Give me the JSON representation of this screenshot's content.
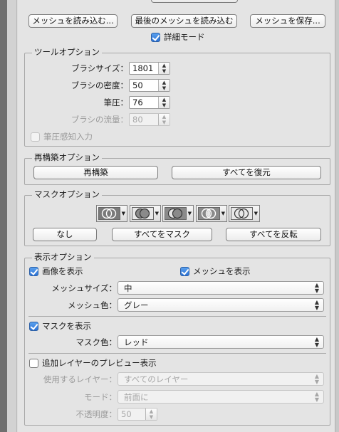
{
  "top_buttons": {
    "load_mesh": "メッシュを読み込む...",
    "load_last_mesh": "最後のメッシュを読み込む",
    "save_mesh": "メッシュを保存..."
  },
  "advanced_mode": {
    "label": "詳細モード",
    "checked": true
  },
  "tool_options": {
    "title": "ツールオプション",
    "brush_size": {
      "label": "ブラシサイズ：",
      "value": "1801"
    },
    "brush_density": {
      "label": "ブラシの密度：",
      "value": "50"
    },
    "brush_pressure": {
      "label": "筆圧：",
      "value": "76"
    },
    "brush_rate": {
      "label": "ブラシの流量：",
      "value": "80"
    },
    "stylus_pressure": {
      "label": "筆圧感知入力",
      "checked": false
    }
  },
  "reconstruct_options": {
    "title": "再構築オプション",
    "reconstruct": "再構築",
    "restore_all": "すべてを復元"
  },
  "mask_options": {
    "title": "マスクオプション",
    "none": "なし",
    "mask_all": "すべてをマスク",
    "invert_all": "すべてを反転"
  },
  "view_options": {
    "title": "表示オプション",
    "show_image": {
      "label": "画像を表示",
      "checked": true
    },
    "show_mesh": {
      "label": "メッシュを表示",
      "checked": true
    },
    "mesh_size": {
      "label": "メッシュサイズ：",
      "value": "中"
    },
    "mesh_color": {
      "label": "メッシュ色：",
      "value": "グレー"
    },
    "show_mask": {
      "label": "マスクを表示",
      "checked": true
    },
    "mask_color": {
      "label": "マスク色：",
      "value": "レッド"
    },
    "show_backdrop": {
      "label": "追加レイヤーのプレビュー表示",
      "checked": false
    },
    "use_layer": {
      "label": "使用するレイヤー：",
      "value": "すべてのレイヤー"
    },
    "mode": {
      "label": "モード：",
      "value": "前面に"
    },
    "opacity": {
      "label": "不透明度：",
      "value": "50"
    }
  },
  "colors": {
    "checkbox_on": "#2d73d5",
    "panel_bg": "#e4e4e4"
  }
}
